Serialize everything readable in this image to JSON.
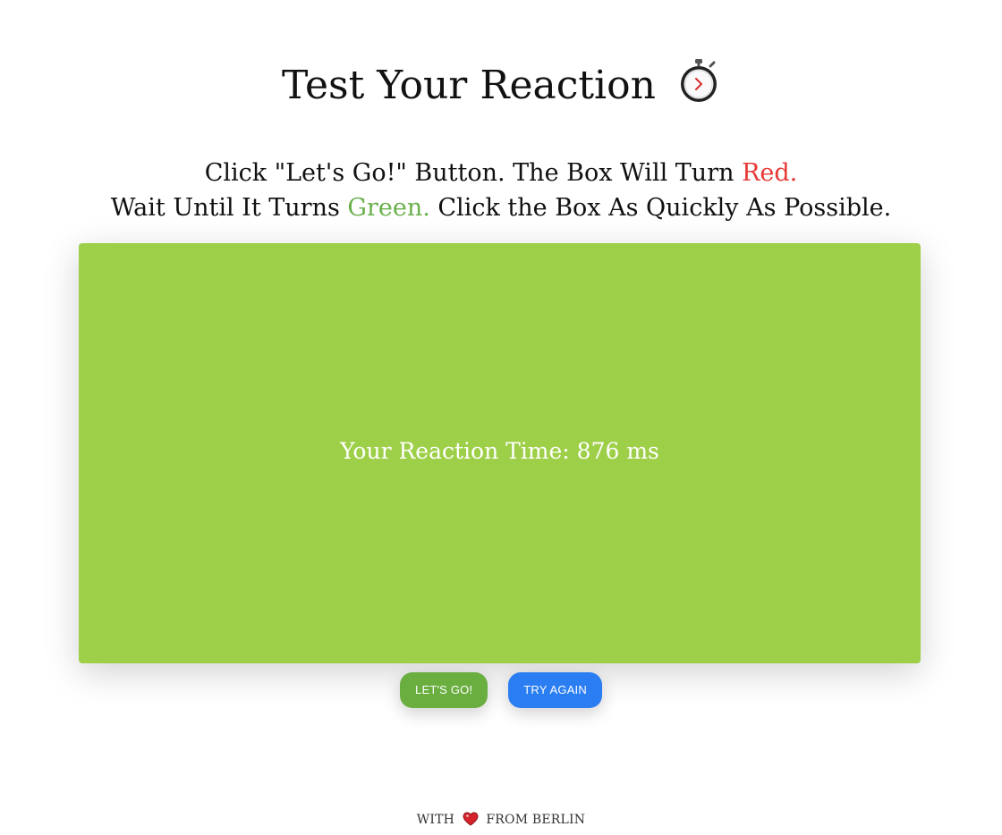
{
  "header": {
    "title": "Test Your Reaction",
    "title_icon": "stopwatch-icon"
  },
  "instructions": {
    "line1_before": "Click \"Let's Go!\" Button. The Box Will Turn ",
    "line1_red": "Red.",
    "line2_before": "Wait Until It Turns ",
    "line2_green": "Green.",
    "line2_after": " Click the Box As Quickly As Possible."
  },
  "box": {
    "result_text": "Your Reaction Time: 876 ms",
    "color": "#9ecf48"
  },
  "buttons": {
    "go_label": "LET'S GO!",
    "again_label": "TRY AGAIN",
    "go_color": "#6aae40",
    "again_color": "#2a7ef2"
  },
  "footer": {
    "before": "WITH",
    "icon": "heart-icon",
    "after": "FROM BERLIN"
  },
  "colors": {
    "red_accent": "#e53935",
    "green_accent": "#6ab04c"
  }
}
